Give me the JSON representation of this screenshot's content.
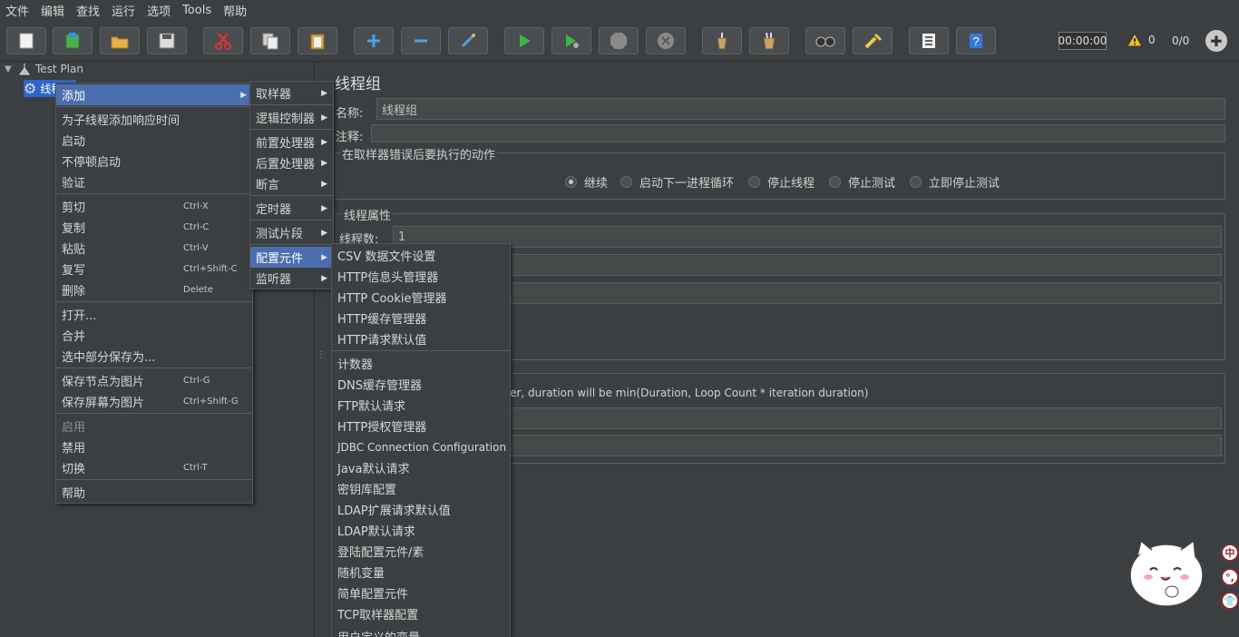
{
  "menubar": [
    "文件",
    "编辑",
    "查找",
    "运行",
    "选项",
    "Tools",
    "帮助"
  ],
  "toolbar": {
    "timer": "00:00:00",
    "warn_count": "0",
    "thread_ratio": "0/0",
    "icons": [
      "new-icon",
      "templates-icon",
      "open-icon",
      "save-icon",
      "cut-icon",
      "copy-icon",
      "paste-icon",
      "expand-icon",
      "collapse-icon",
      "toggle-icon",
      "start-icon",
      "start-no-pause-icon",
      "stop-icon",
      "shutdown-icon",
      "clear-icon",
      "clear-all-icon",
      "search-icon",
      "reset-search-icon",
      "function-helper-icon",
      "help-icon"
    ]
  },
  "tree": {
    "root": "Test Plan",
    "child": "线程组"
  },
  "main": {
    "title": "线程组",
    "name_label": "名称:",
    "name_value": "线程组",
    "comment_label": "注释:",
    "error_group": "在取样器错误后要执行的动作",
    "radios": [
      "继续",
      "启动下一进程循环",
      "停止线程",
      "停止测试",
      "立即停止测试"
    ],
    "thread_group": "线程属性",
    "threads_label": "线程数:",
    "threads_value": "1",
    "duration_note": "ver, duration will be min(Duration, Loop Count * iteration duration)"
  },
  "context_menu": [
    {
      "label": "添加",
      "shortcut": "",
      "arrow": true
    },
    {
      "label": "为子线程添加响应时间",
      "shortcut": ""
    },
    {
      "label": "启动",
      "shortcut": ""
    },
    {
      "label": "不停顿启动",
      "shortcut": ""
    },
    {
      "label": "验证",
      "shortcut": ""
    },
    {
      "label": "剪切",
      "shortcut": "Ctrl-X"
    },
    {
      "label": "复制",
      "shortcut": "Ctrl-C"
    },
    {
      "label": "粘贴",
      "shortcut": "Ctrl-V"
    },
    {
      "label": "复写",
      "shortcut": "Ctrl+Shift-C"
    },
    {
      "label": "删除",
      "shortcut": "Delete"
    },
    {
      "label": "打开...",
      "shortcut": ""
    },
    {
      "label": "合并",
      "shortcut": ""
    },
    {
      "label": "选中部分保存为...",
      "shortcut": ""
    },
    {
      "label": "保存节点为图片",
      "shortcut": "Ctrl-G"
    },
    {
      "label": "保存屏幕为图片",
      "shortcut": "Ctrl+Shift-G"
    },
    {
      "label": "启用",
      "shortcut": ""
    },
    {
      "label": "禁用",
      "shortcut": ""
    },
    {
      "label": "切换",
      "shortcut": "Ctrl-T"
    },
    {
      "label": "帮助",
      "shortcut": ""
    }
  ],
  "add_submenu": [
    "取样器",
    "逻辑控制器",
    "前置处理器",
    "后置处理器",
    "断言",
    "定时器",
    "测试片段",
    "配置元件",
    "监听器"
  ],
  "config_submenu": [
    "CSV 数据文件设置",
    "HTTP信息头管理器",
    "HTTP Cookie管理器",
    "HTTP缓存管理器",
    "HTTP请求默认值",
    "计数器",
    "DNS缓存管理器",
    "FTP默认请求",
    "HTTP授权管理器",
    "JDBC Connection Configuration",
    "Java默认请求",
    "密钥库配置",
    "LDAP扩展请求默认值",
    "LDAP默认请求",
    "登陆配置元件/素",
    "随机变量",
    "简单配置元件",
    "TCP取样器配置",
    "用户定义的变量"
  ],
  "ime": [
    "中",
    "°,",
    "👕"
  ]
}
